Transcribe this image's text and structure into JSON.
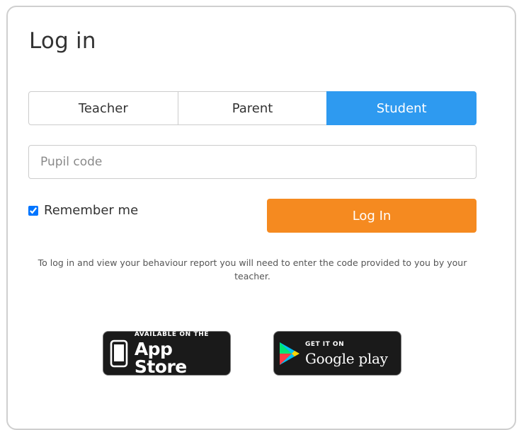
{
  "login": {
    "title": "Log in",
    "tabs": [
      {
        "label": "Teacher",
        "active": false
      },
      {
        "label": "Parent",
        "active": false
      },
      {
        "label": "Student",
        "active": true
      }
    ],
    "pupil_code": {
      "placeholder": "Pupil code",
      "value": ""
    },
    "remember_me": {
      "label": "Remember me",
      "checked": true
    },
    "login_button_label": "Log In",
    "info_text": "To log in and view your behaviour report you will need to enter the code provided to you by your teacher."
  },
  "badges": {
    "app_store": {
      "small": "AVAILABLE ON THE",
      "big": "App Store",
      "icon": "phone-icon"
    },
    "google_play": {
      "small": "GET IT ON",
      "big": "Google play",
      "icon": "play-triangle-icon"
    }
  },
  "colors": {
    "accent_blue": "#2e9af0",
    "login_orange": "#f58a20",
    "border_grey": "#cccccc",
    "text_dark": "#333333"
  }
}
